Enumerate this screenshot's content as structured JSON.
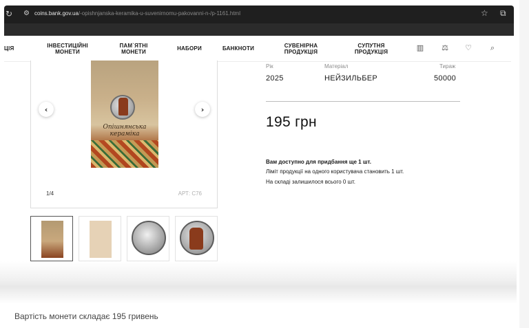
{
  "browser": {
    "url_host": "coins.bank.gov.ua",
    "url_path": "/-opishnjanska-keramika-u-suvenirnomu-pakovanni-n-/p-1161.html",
    "icons": {
      "reload": "reload-icon",
      "tune": "site-settings-icon",
      "star": "bookmark-star-icon",
      "extensions": "extensions-icon"
    }
  },
  "nav": {
    "items": [
      {
        "label": "ЦІЯ"
      },
      {
        "label": "ІНВЕСТИЦІЙНІ\nМОНЕТИ"
      },
      {
        "label": "ПАМ`ЯТНІ\nМОНЕТИ"
      },
      {
        "label": "НАБОРИ"
      },
      {
        "label": "БАНКНОТИ"
      },
      {
        "label": "СУВЕНІРНА\nПРОДУКЦІЯ"
      },
      {
        "label": "СУПУТНЯ\nПРОДУКЦІЯ"
      }
    ],
    "icons": [
      "chart-icon",
      "compare-icon",
      "heart-icon",
      "search-icon"
    ]
  },
  "gallery": {
    "booklet_title": "Опішнянська\nкераміка",
    "counter": "1/4",
    "article": "АРТ: С76",
    "thumbnails": [
      "booklet-front",
      "booklet-back",
      "coin-reverse",
      "coin-obverse"
    ]
  },
  "product": {
    "attributes": [
      {
        "label": "Рік",
        "value": "2025"
      },
      {
        "label": "Матеріал",
        "value": "НЕЙЗИЛЬБЕР"
      },
      {
        "label": "Тираж",
        "value": "50000"
      }
    ],
    "price": "195 грн",
    "availability_title": "Вам доступно для придбання ще 1 шт.",
    "limit_text": "Ліміт продукції на одного користувача становить 1 шт.",
    "stock_text": "На складі залишилося всього 0 шт."
  },
  "caption": "Вартість монети складає 195 гривень"
}
